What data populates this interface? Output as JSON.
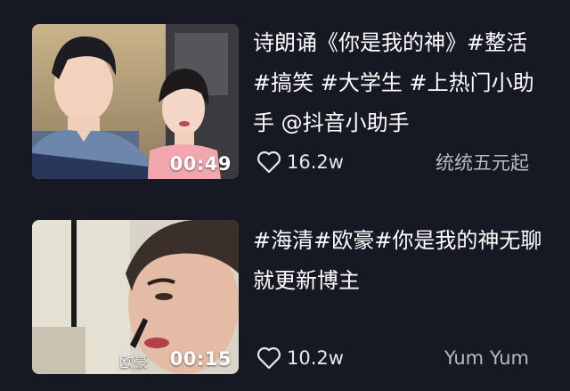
{
  "videos": [
    {
      "title": "诗朗诵《你是我的神》#整活 #搞笑 #大学生 #上热门小助手 @抖音小助手",
      "duration": "00:49",
      "likes": "16.2w",
      "author": "统统五元起",
      "thumbnail_icon": "thumbnail-image",
      "like_icon": "heart-outline-icon"
    },
    {
      "title": "#海清#欧豪#你是我的神无聊就更新博主",
      "duration": "00:15",
      "watermark": "欧豪",
      "likes": "10.2w",
      "author": "Yum Yum",
      "thumbnail_icon": "thumbnail-image",
      "like_icon": "heart-outline-icon"
    }
  ],
  "colors": {
    "background": "#161823",
    "title_text": "#ffffff",
    "meta_text": "#e8e8ea",
    "author_text": "#b9bac0"
  }
}
